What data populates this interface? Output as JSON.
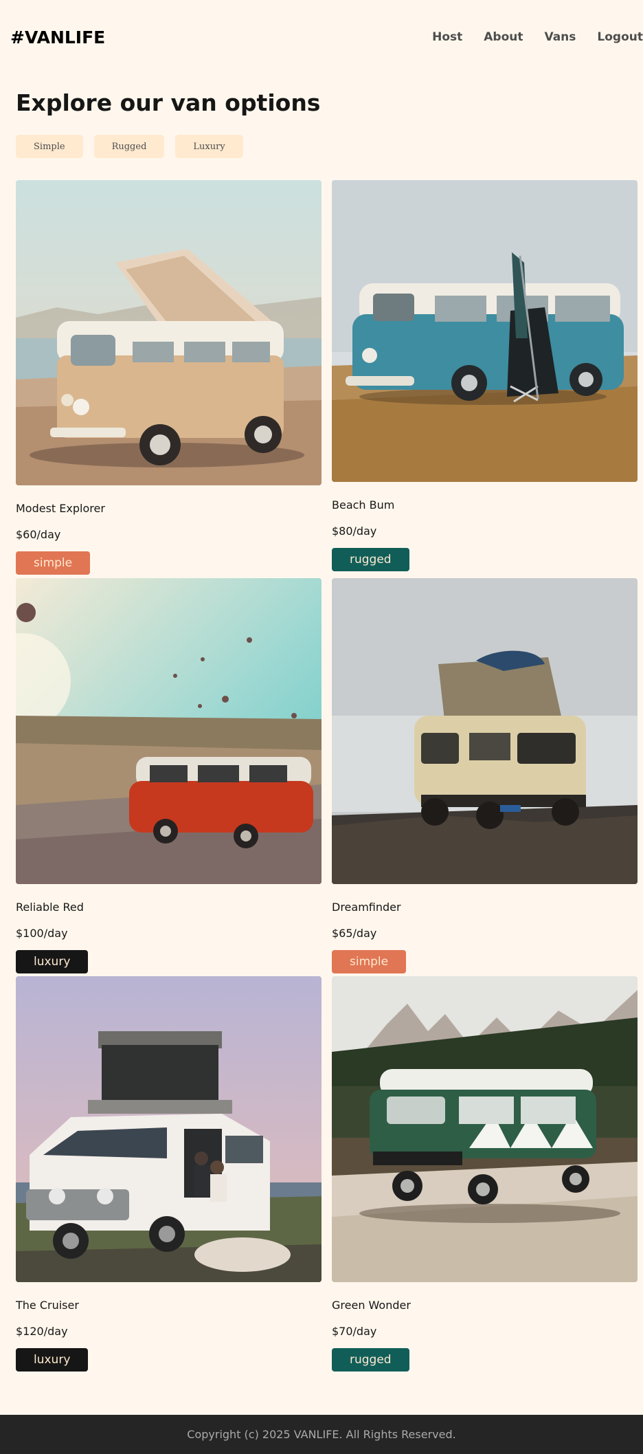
{
  "header": {
    "logo": "#VANLIFE",
    "nav": [
      "Host",
      "About",
      "Vans",
      "Logout"
    ]
  },
  "main": {
    "title": "Explore our van options",
    "filters": [
      "Simple",
      "Rugged",
      "Luxury"
    ],
    "vans": [
      {
        "name": "Modest Explorer",
        "price": "$60/day",
        "type": "simple",
        "type_color": "#E17654",
        "scene": "beige camper van with pop-up roof by the sea"
      },
      {
        "name": "Beach Bum",
        "price": "$80/day",
        "type": "rugged",
        "type_color": "#115E59",
        "scene": "blue vintage van on a field with beach chair and umbrella"
      },
      {
        "name": "Reliable Red",
        "price": "$100/day",
        "type": "luxury",
        "type_color": "#161616",
        "scene": "red van on a cliff with hot air balloons"
      },
      {
        "name": "Dreamfinder",
        "price": "$65/day",
        "type": "simple",
        "type_color": "#E17654",
        "scene": "cream camper with surfboard on roof above fog"
      },
      {
        "name": "The Cruiser",
        "price": "$120/day",
        "type": "luxury",
        "type_color": "#161616",
        "scene": "white expedition van with rooftop tent and couple"
      },
      {
        "name": "Green Wonder",
        "price": "$70/day",
        "type": "rugged",
        "type_color": "#115E59",
        "scene": "green and white van in front of mountains and lake"
      }
    ]
  },
  "footer": {
    "text": "Copyright (c) 2025 VANLIFE. All Rights Reserved."
  }
}
